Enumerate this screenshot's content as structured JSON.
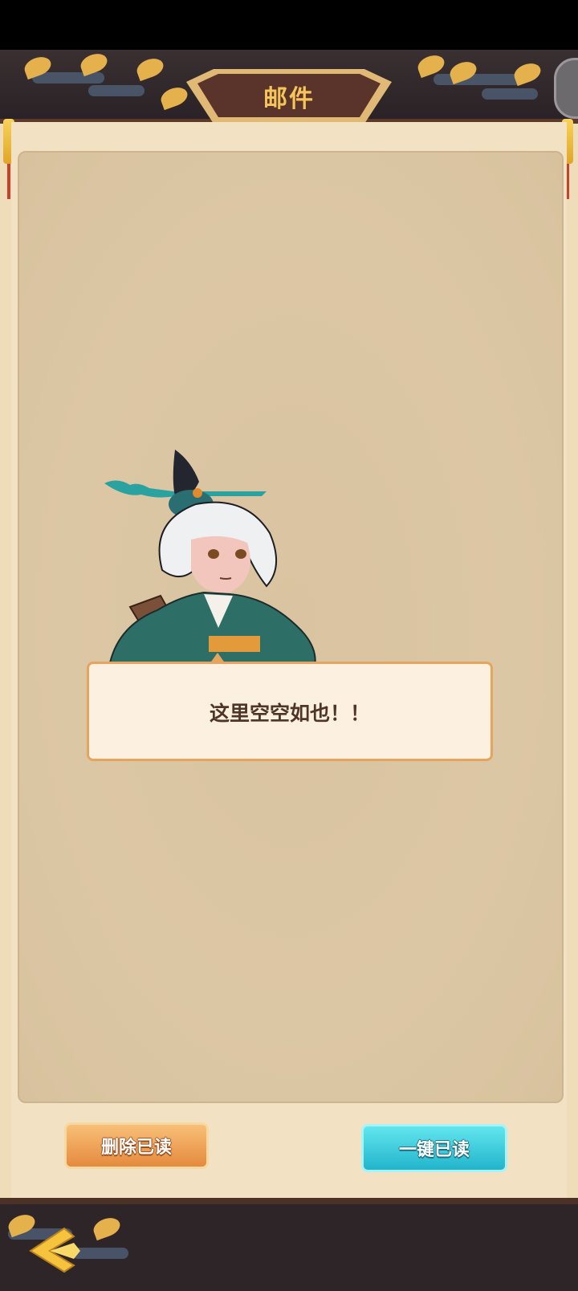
{
  "header": {
    "title": "邮件"
  },
  "mail": {
    "empty_message": "这里空空如也！！"
  },
  "actions": {
    "delete_read_label": "删除已读",
    "mark_all_read_label": "一键已读"
  },
  "colors": {
    "accent_gold": "#f5c55a",
    "delete_button": "#e58a3d",
    "read_button": "#22b4cc",
    "panel": "#dcc7a5"
  },
  "icons": {
    "back": "back-arrow-icon",
    "corner": "circle-button-icon"
  }
}
